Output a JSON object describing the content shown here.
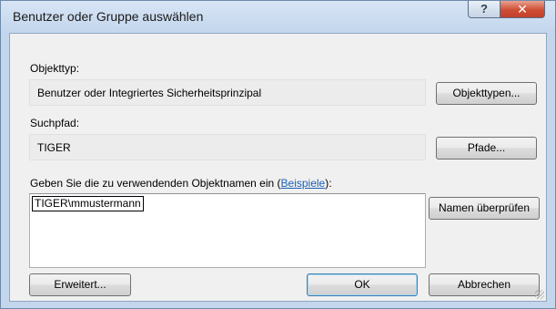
{
  "window": {
    "title": "Benutzer oder Gruppe auswählen",
    "help_glyph": "?",
    "close_glyph": "✕"
  },
  "object_type": {
    "label": "Objekttyp:",
    "value": "Benutzer oder Integriertes Sicherheitsprinzipal",
    "button": "Objekttypen..."
  },
  "search_path": {
    "label": "Suchpfad:",
    "value": "TIGER",
    "button": "Pfade..."
  },
  "names": {
    "prompt_prefix": "Geben Sie die zu verwendenden Objektnamen ein (",
    "examples_link": "Beispiele",
    "prompt_suffix": "):",
    "value": "TIGER\\mmustermann",
    "check_button": "Namen überprüfen"
  },
  "footer": {
    "advanced_button": "Erweitert...",
    "ok_button": "OK",
    "cancel_button": "Abbrechen"
  }
}
